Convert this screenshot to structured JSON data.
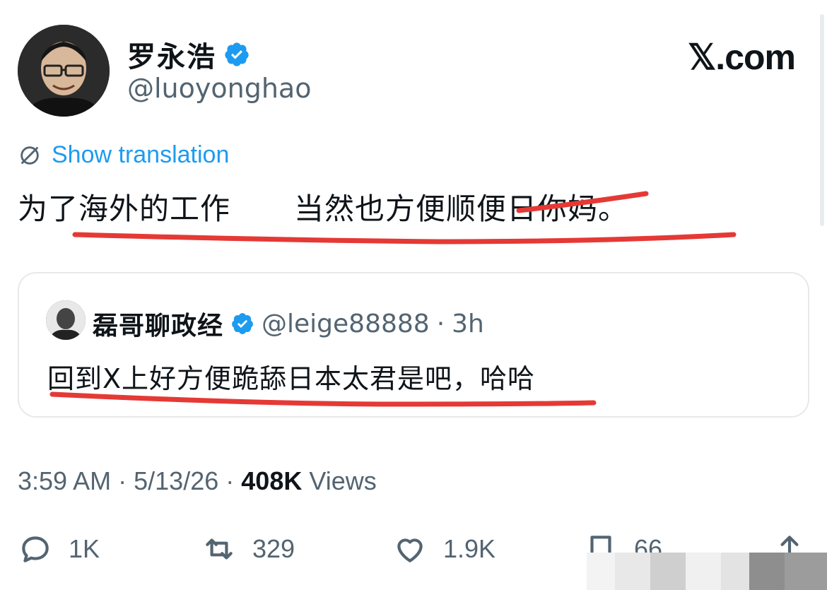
{
  "header": {
    "display_name": "罗永浩",
    "handle": "@luoyonghao",
    "brand": "𝕏.com"
  },
  "translation": {
    "label": "Show translation",
    "icon": "translate-icon"
  },
  "tweet": {
    "text_part1": "为了海外的工作",
    "text_part2": "当然也方便顺便日你妈。"
  },
  "quoted": {
    "display_name": "磊哥聊政经",
    "handle": "@leige88888",
    "separator": "·",
    "time": "3h",
    "text": "回到X上好方便跪舔日本太君是吧，哈哈"
  },
  "meta": {
    "time": "3:59 AM",
    "date": "5/13/26",
    "sep": "·",
    "views_count": "408K",
    "views_label": "Views"
  },
  "actions": {
    "replies": "1K",
    "reposts": "329",
    "likes": "1.9K",
    "bookmarks": "66"
  },
  "colors": {
    "accent": "#1d9bf0",
    "annotation": "#e53935",
    "text": "#0f1419",
    "muted": "#536471"
  }
}
